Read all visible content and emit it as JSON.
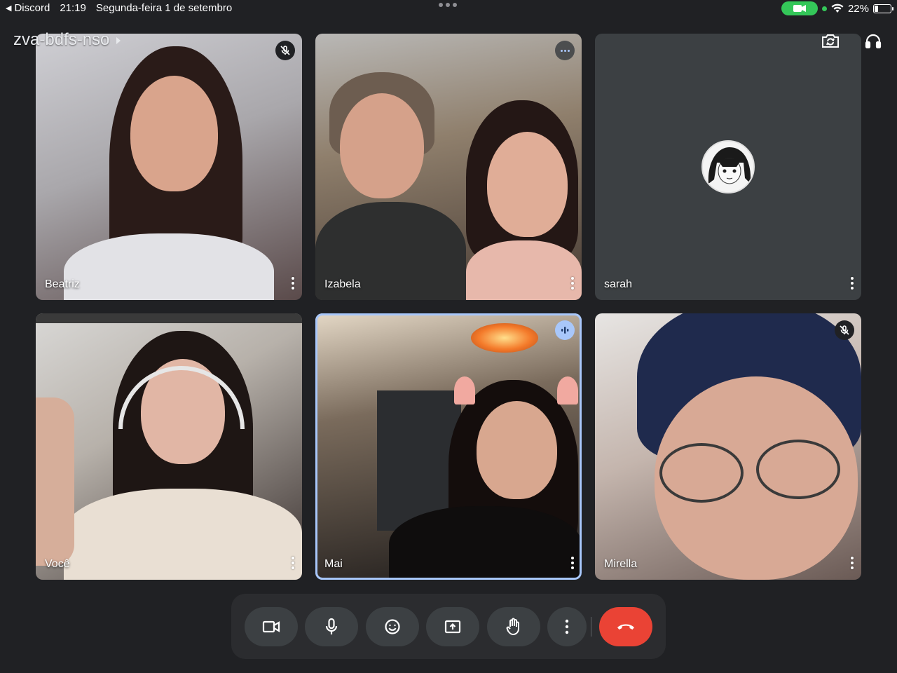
{
  "status_bar": {
    "back_app": "Discord",
    "time": "21:19",
    "date": "Segunda-feira 1 de setembro",
    "battery": "22%",
    "battery_level": 0.22
  },
  "meeting": {
    "code": "zva-bdfs-nso"
  },
  "participants": [
    {
      "name": "Beatriz",
      "status": "muted"
    },
    {
      "name": "Izabela",
      "status": "more"
    },
    {
      "name": "sarah",
      "status": "none"
    },
    {
      "name": "Você",
      "status": "none"
    },
    {
      "name": "Mai",
      "status": "speaking"
    },
    {
      "name": "Mirella",
      "status": "muted"
    }
  ],
  "controls": [
    {
      "name": "camera",
      "icon": "video-camera-icon"
    },
    {
      "name": "microphone",
      "icon": "microphone-icon"
    },
    {
      "name": "reactions",
      "icon": "emoji-icon"
    },
    {
      "name": "present",
      "icon": "present-screen-icon"
    },
    {
      "name": "raise-hand",
      "icon": "hand-icon"
    },
    {
      "name": "more",
      "icon": "more-vertical-icon"
    },
    {
      "name": "hang-up",
      "icon": "phone-hangup-icon"
    }
  ],
  "colors": {
    "background": "#202124",
    "speaking_border": "#a8c7fa",
    "hangup": "#ea4335",
    "control_bg": "#3c4043"
  }
}
